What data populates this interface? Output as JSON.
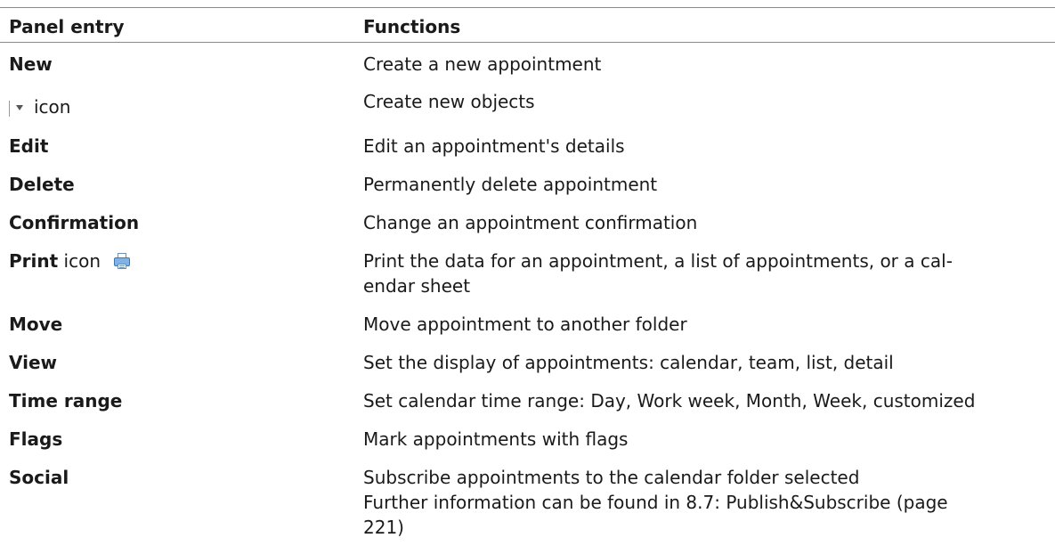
{
  "table": {
    "headers": {
      "entry": "Panel entry",
      "functions": "Functions"
    },
    "rows": [
      {
        "entry": "New",
        "function": "Create a new appointment"
      },
      {
        "entry": "icon",
        "function": "Create new objects",
        "icon": "dropdown-arrow-icon"
      },
      {
        "entry": "Edit",
        "function": "Edit an appointment's details"
      },
      {
        "entry": "Delete",
        "function": "Permanently delete appointment"
      },
      {
        "entry": "Confirmation",
        "function": "Change an appointment confirmation"
      },
      {
        "entry": "Print",
        "entry_suffix": " icon",
        "function_line1": "Print the data for an appointment, a list of appointments, or a cal-",
        "function_line2": "endar sheet",
        "icon": "printer-icon"
      },
      {
        "entry": "Move",
        "function": "Move appointment to another folder"
      },
      {
        "entry": "View",
        "function": "Set the display of appointments: calendar, team, list, detail"
      },
      {
        "entry": "Time range",
        "function": "Set calendar time range: Day, Work week, Month, Week, customized"
      },
      {
        "entry": "Flags",
        "function": "Mark appointments with flags"
      },
      {
        "entry": "Social",
        "function_line1": "Subscribe appointments to the calendar folder selected",
        "function_line2": "Further information can be found in 8.7: Publish&Subscribe (page",
        "function_line3": "221)"
      }
    ]
  },
  "colors": {
    "rule": "#8a8a8a",
    "text": "#1a1a1a",
    "printer_blue": "#7fb2e6"
  }
}
